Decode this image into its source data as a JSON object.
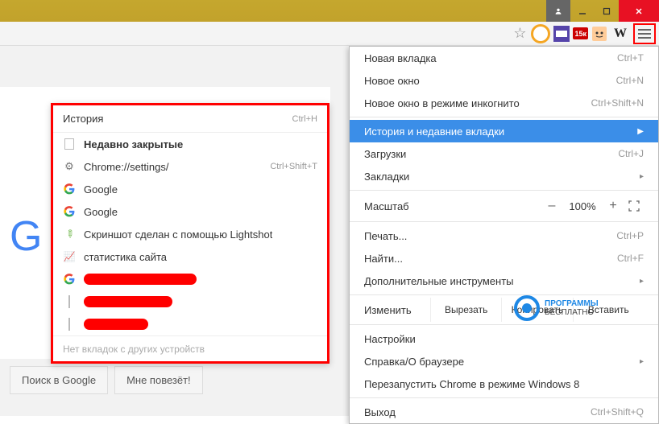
{
  "titlebar": {
    "account": "user-icon"
  },
  "toolbar": {
    "red_badge": "15к",
    "w": "W"
  },
  "google": {
    "visible_letters": "G"
  },
  "search_buttons": {
    "search": "Поиск в Google",
    "lucky": "Мне повезёт!"
  },
  "submenu": {
    "header": {
      "label": "История",
      "shortcut": "Ctrl+H"
    },
    "recent_label": "Недавно закрытые",
    "items": [
      {
        "icon": "gear",
        "label": "Chrome://settings/",
        "shortcut": "Ctrl+Shift+T"
      },
      {
        "icon": "google",
        "label": "Google"
      },
      {
        "icon": "google",
        "label": "Google"
      },
      {
        "icon": "pencil",
        "label": "Скриншот сделан с помощью Lightshot"
      },
      {
        "icon": "chart",
        "label": "статистика сайта"
      },
      {
        "icon": "google",
        "label": "",
        "redacted": true,
        "redact_w": 140
      },
      {
        "icon": "doc",
        "label": "",
        "redacted": true,
        "redact_w": 110
      },
      {
        "icon": "doc",
        "label": "",
        "redacted": true,
        "redact_w": 80
      }
    ],
    "footer": "Нет вкладок с других устройств"
  },
  "mainmenu": {
    "items1": [
      {
        "label": "Новая вкладка",
        "shortcut": "Ctrl+T"
      },
      {
        "label": "Новое окно",
        "shortcut": "Ctrl+N"
      },
      {
        "label": "Новое окно в режиме инкогнито",
        "shortcut": "Ctrl+Shift+N"
      }
    ],
    "highlighted": {
      "label": "История и недавние вкладки"
    },
    "items2": [
      {
        "label": "Загрузки",
        "shortcut": "Ctrl+J"
      },
      {
        "label": "Закладки",
        "arrow": true
      }
    ],
    "zoom": {
      "label": "Масштаб",
      "minus": "–",
      "value": "100%",
      "plus": "+"
    },
    "items3": [
      {
        "label": "Печать...",
        "shortcut": "Ctrl+P"
      },
      {
        "label": "Найти...",
        "shortcut": "Ctrl+F"
      },
      {
        "label": "Дополнительные инструменты",
        "arrow": true
      }
    ],
    "edit": {
      "label": "Изменить",
      "cut": "Вырезать",
      "copy": "Копировать",
      "paste": "Вставить"
    },
    "items4": [
      {
        "label": "Настройки"
      },
      {
        "label": "Справка/О браузере",
        "arrow": true
      },
      {
        "label": "Перезапустить Chrome в режиме Windows 8"
      }
    ],
    "items5": [
      {
        "label": "Выход",
        "shortcut": "Ctrl+Shift+Q"
      }
    ]
  },
  "overlay_logo": {
    "line1": "ПРОГРАММЫ",
    "line2": "БЕСПЛАТНО"
  }
}
